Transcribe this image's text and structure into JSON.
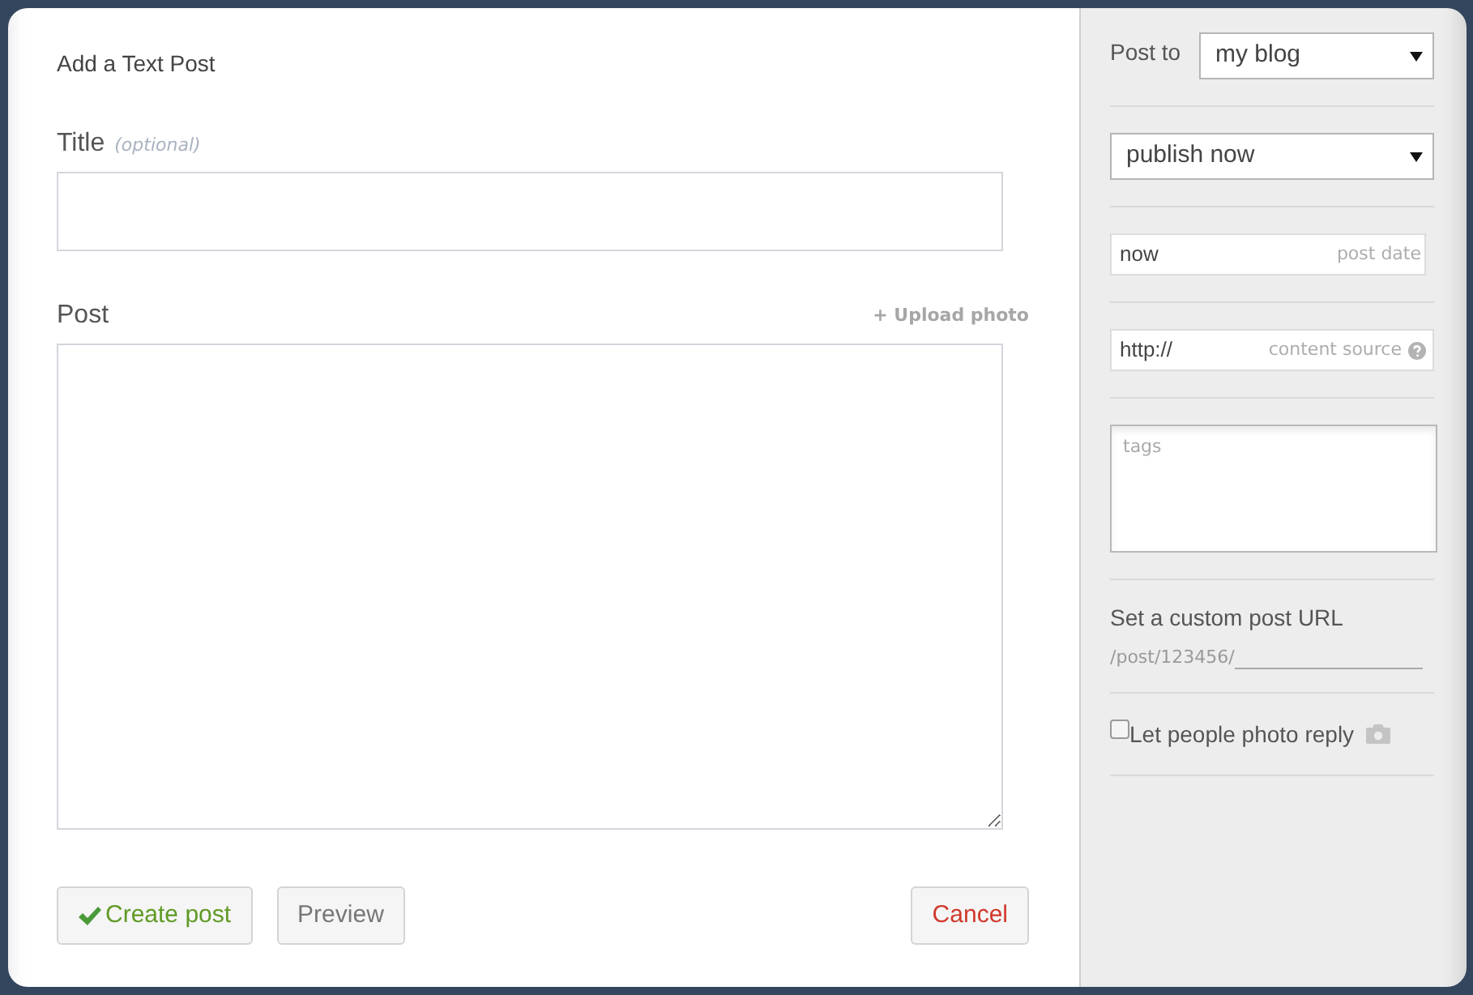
{
  "heading": "Add a Text Post",
  "title_field": {
    "label": "Title",
    "hint": "(optional)"
  },
  "post_field": {
    "label": "Post",
    "upload_link": "+ Upload photo"
  },
  "buttons": [
    {
      "kind": "create",
      "label": "Create post"
    },
    {
      "kind": "preview",
      "label": "Preview"
    },
    {
      "kind": "cancel",
      "label": "Cancel"
    }
  ],
  "sidebar": {
    "post_to": {
      "label": "Post to",
      "value": "my blog"
    },
    "publish": {
      "value": "publish now"
    },
    "post_date": {
      "value": "now",
      "label": "post date"
    },
    "content_source": {
      "value": "http://",
      "label": "content source"
    },
    "tags": {
      "placeholder": "tags"
    },
    "custom_url": {
      "label": "Set a custom post URL",
      "prefix": "/post/123456/"
    },
    "photo_reply": {
      "label": "Let people photo reply",
      "checked": false
    }
  }
}
